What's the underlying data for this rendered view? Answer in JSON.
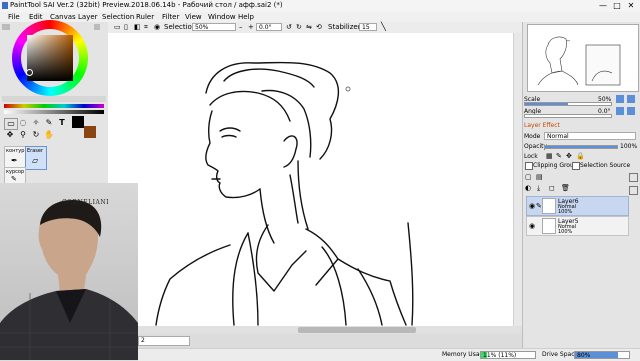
{
  "window": {
    "title": "PaintTool SAI Ver.2 (32bit) Preview.2018.06.14b - Рабочий стол / афф.sai2 (*)",
    "controls": [
      "—",
      "□",
      "✕"
    ]
  },
  "menu": [
    "File",
    "Edit",
    "Canvas",
    "Layer",
    "Selection",
    "Ruler",
    "Filter",
    "View",
    "Window",
    "Help"
  ],
  "toolbar": {
    "selection_label": "Selection",
    "zoom": "50%",
    "angle": "0.0°",
    "stabilizer_label": "Stabilizer",
    "stabilizer_value": "15"
  },
  "tools": {
    "brush_labels": [
      "контур",
      "курсор"
    ],
    "eraser_label": "Eraser",
    "text_tool": "T",
    "fg_color": "#000000",
    "bg_color": "#8b4513"
  },
  "navigator": {
    "scale_label": "Scale",
    "scale_value": "50%",
    "angle_label": "Angle",
    "angle_value": "0.0°",
    "scale_fraction": 0.5
  },
  "layer_panel": {
    "effect_label": "Layer Effect",
    "mode_label": "Mode",
    "mode_value": "Normal",
    "opacity_label": "Opacity",
    "opacity_value": "100%",
    "opacity_fraction": 1.0,
    "lock_label": "Lock",
    "clipping_label": "Clipping Group",
    "selection_source_label": "Selection Source",
    "layers": [
      {
        "name": "Layer6",
        "mode": "Normal",
        "opacity": "100%"
      },
      {
        "name": "Layer5",
        "mode": "Normal",
        "opacity": "100%"
      }
    ]
  },
  "photo": {
    "brand": "CORNELIANI"
  },
  "status": {
    "memory_label": "Memory Usage",
    "memory_value": "11% (11%)",
    "memory_fraction": 0.11,
    "drive_label": "Drive Space",
    "drive_value": "80%",
    "drive_fraction": 0.8,
    "brush_size": "2"
  },
  "colors": {
    "accent": "#5b8fd8",
    "selected_layer": "#c7d7f0",
    "status_fill": "#3fd96a"
  }
}
